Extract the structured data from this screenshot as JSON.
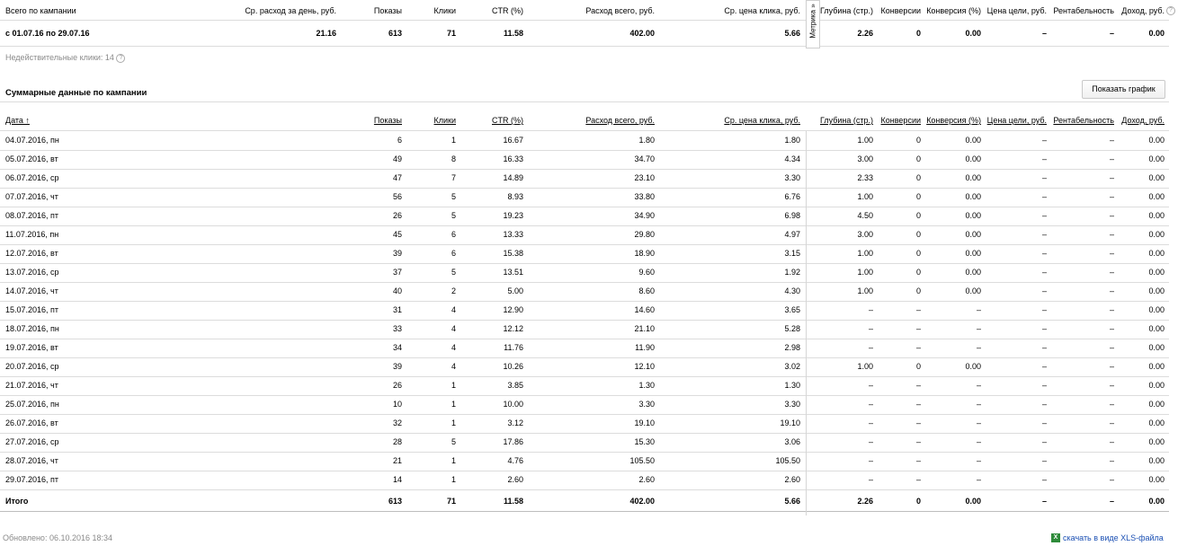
{
  "summary": {
    "headers": {
      "total": "Всего по кампании",
      "avg_spend": "Ср. расход за день, руб.",
      "shows": "Показы",
      "clicks": "Клики",
      "ctr": "CTR (%)",
      "spend": "Расход всего, руб.",
      "cpc": "Ср. цена клика, руб.",
      "depth": "Глубина (стр.)",
      "conv": "Конверсии",
      "conv_pct": "Конверсия (%)",
      "goal_price": "Цена цели, руб.",
      "profit": "Рентабельность",
      "income": "Доход, руб."
    },
    "row": {
      "period": "с 01.07.16 по 29.07.16",
      "avg_spend": "21.16",
      "shows": "613",
      "clicks": "71",
      "ctr": "11.58",
      "spend": "402.00",
      "cpc": "5.66",
      "depth": "2.26",
      "conv": "0",
      "conv_pct": "0.00",
      "goal_price": "–",
      "profit": "–",
      "income": "0.00"
    },
    "metrika_label": "Метрика »",
    "invalid_clicks_label": "Недействительные клики: 14",
    "help_icon": "?"
  },
  "section": {
    "title": "Суммарные данные по кампании",
    "show_chart_button": "Показать график"
  },
  "table": {
    "headers": {
      "date": "Дата ↑",
      "shows": "Показы",
      "clicks": "Клики",
      "ctr": "CTR (%)",
      "spend": "Расход всего, руб.",
      "cpc": "Ср. цена клика, руб.",
      "depth": "Глубина (стр.)",
      "conv": "Конверсии",
      "conv_pct": "Конверсия (%)",
      "goal_price": "Цена цели, руб.",
      "profit": "Рентабельность",
      "income": "Доход, руб."
    },
    "rows": [
      [
        "04.07.2016, пн",
        "6",
        "1",
        "16.67",
        "1.80",
        "1.80",
        "1.00",
        "0",
        "0.00",
        "–",
        "–",
        "0.00"
      ],
      [
        "05.07.2016, вт",
        "49",
        "8",
        "16.33",
        "34.70",
        "4.34",
        "3.00",
        "0",
        "0.00",
        "–",
        "–",
        "0.00"
      ],
      [
        "06.07.2016, ср",
        "47",
        "7",
        "14.89",
        "23.10",
        "3.30",
        "2.33",
        "0",
        "0.00",
        "–",
        "–",
        "0.00"
      ],
      [
        "07.07.2016, чт",
        "56",
        "5",
        "8.93",
        "33.80",
        "6.76",
        "1.00",
        "0",
        "0.00",
        "–",
        "–",
        "0.00"
      ],
      [
        "08.07.2016, пт",
        "26",
        "5",
        "19.23",
        "34.90",
        "6.98",
        "4.50",
        "0",
        "0.00",
        "–",
        "–",
        "0.00"
      ],
      [
        "11.07.2016, пн",
        "45",
        "6",
        "13.33",
        "29.80",
        "4.97",
        "3.00",
        "0",
        "0.00",
        "–",
        "–",
        "0.00"
      ],
      [
        "12.07.2016, вт",
        "39",
        "6",
        "15.38",
        "18.90",
        "3.15",
        "1.00",
        "0",
        "0.00",
        "–",
        "–",
        "0.00"
      ],
      [
        "13.07.2016, ср",
        "37",
        "5",
        "13.51",
        "9.60",
        "1.92",
        "1.00",
        "0",
        "0.00",
        "–",
        "–",
        "0.00"
      ],
      [
        "14.07.2016, чт",
        "40",
        "2",
        "5.00",
        "8.60",
        "4.30",
        "1.00",
        "0",
        "0.00",
        "–",
        "–",
        "0.00"
      ],
      [
        "15.07.2016, пт",
        "31",
        "4",
        "12.90",
        "14.60",
        "3.65",
        "–",
        "–",
        "–",
        "–",
        "–",
        "0.00"
      ],
      [
        "18.07.2016, пн",
        "33",
        "4",
        "12.12",
        "21.10",
        "5.28",
        "–",
        "–",
        "–",
        "–",
        "–",
        "0.00"
      ],
      [
        "19.07.2016, вт",
        "34",
        "4",
        "11.76",
        "11.90",
        "2.98",
        "–",
        "–",
        "–",
        "–",
        "–",
        "0.00"
      ],
      [
        "20.07.2016, ср",
        "39",
        "4",
        "10.26",
        "12.10",
        "3.02",
        "1.00",
        "0",
        "0.00",
        "–",
        "–",
        "0.00"
      ],
      [
        "21.07.2016, чт",
        "26",
        "1",
        "3.85",
        "1.30",
        "1.30",
        "–",
        "–",
        "–",
        "–",
        "–",
        "0.00"
      ],
      [
        "25.07.2016, пн",
        "10",
        "1",
        "10.00",
        "3.30",
        "3.30",
        "–",
        "–",
        "–",
        "–",
        "–",
        "0.00"
      ],
      [
        "26.07.2016, вт",
        "32",
        "1",
        "3.12",
        "19.10",
        "19.10",
        "–",
        "–",
        "–",
        "–",
        "–",
        "0.00"
      ],
      [
        "27.07.2016, ср",
        "28",
        "5",
        "17.86",
        "15.30",
        "3.06",
        "–",
        "–",
        "–",
        "–",
        "–",
        "0.00"
      ],
      [
        "28.07.2016, чт",
        "21",
        "1",
        "4.76",
        "105.50",
        "105.50",
        "–",
        "–",
        "–",
        "–",
        "–",
        "0.00"
      ],
      [
        "29.07.2016, пт",
        "14",
        "1",
        "2.60",
        "2.60",
        "2.60",
        "–",
        "–",
        "–",
        "–",
        "–",
        "0.00"
      ]
    ],
    "total": [
      "Итого",
      "613",
      "71",
      "11.58",
      "402.00",
      "5.66",
      "2.26",
      "0",
      "0.00",
      "–",
      "–",
      "0.00"
    ]
  },
  "footer": {
    "updated": "Обновлено: 06.10.2016 18:34",
    "xls_link": "скачать в виде XLS-файла"
  }
}
